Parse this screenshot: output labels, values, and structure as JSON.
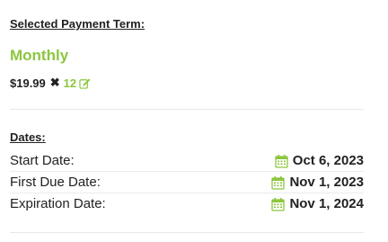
{
  "payment": {
    "section_label": "Selected Payment Term:",
    "term": "Monthly",
    "price": "$19.99",
    "times_symbol": "✖",
    "count": "12"
  },
  "dates": {
    "section_label": "Dates:",
    "rows": [
      {
        "label": "Start Date:",
        "value": "Oct 6, 2023"
      },
      {
        "label": "First Due Date:",
        "value": "Nov 1, 2023"
      },
      {
        "label": "Expiration Date:",
        "value": "Nov 1, 2024"
      }
    ]
  },
  "colors": {
    "accent": "#8cc63f",
    "text": "#222222",
    "divider": "#e8e8e8"
  },
  "icons": {
    "edit": "pencil-square-icon",
    "calendar": "calendar-icon"
  }
}
